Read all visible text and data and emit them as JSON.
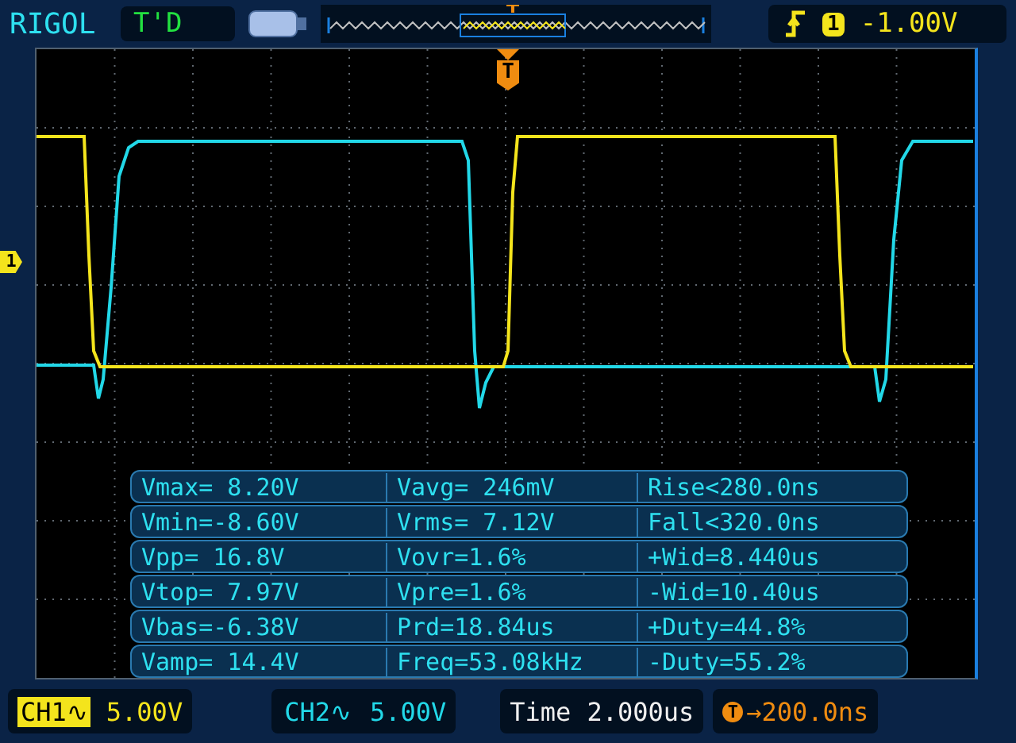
{
  "header": {
    "brand": "RIGOL",
    "run_status": "T'D",
    "trigger": {
      "source": "1",
      "level": "-1.00V"
    }
  },
  "plot": {
    "trigger_marker": "T",
    "ch1_marker": "1",
    "measurements": [
      [
        "Vmax= 8.20V",
        "Vavg= 246mV",
        "Rise<280.0ns"
      ],
      [
        "Vmin=-8.60V",
        "Vrms= 7.12V",
        "Fall<320.0ns"
      ],
      [
        "Vpp= 16.8V",
        "Vovr=1.6%",
        "+Wid=8.440us"
      ],
      [
        "Vtop= 7.97V",
        "Vpre=1.6%",
        "-Wid=10.40us"
      ],
      [
        "Vbas=-6.38V",
        "Prd=18.84us",
        "+Duty=44.8%"
      ],
      [
        "Vamp= 14.4V",
        "Freq=53.08kHz",
        "-Duty=55.2%"
      ]
    ]
  },
  "footer": {
    "channels": [
      {
        "label": "CH1∿",
        "scale": "5.00V",
        "selected": true,
        "color": "#f4e41c"
      },
      {
        "label": "CH2∿",
        "scale": "5.00V",
        "selected": false,
        "color": "#22d8e8"
      }
    ],
    "timebase": {
      "label": "Time",
      "value": "2.000us"
    },
    "trigger_offset": {
      "badge": "T",
      "value": "→200.0ns"
    }
  }
}
